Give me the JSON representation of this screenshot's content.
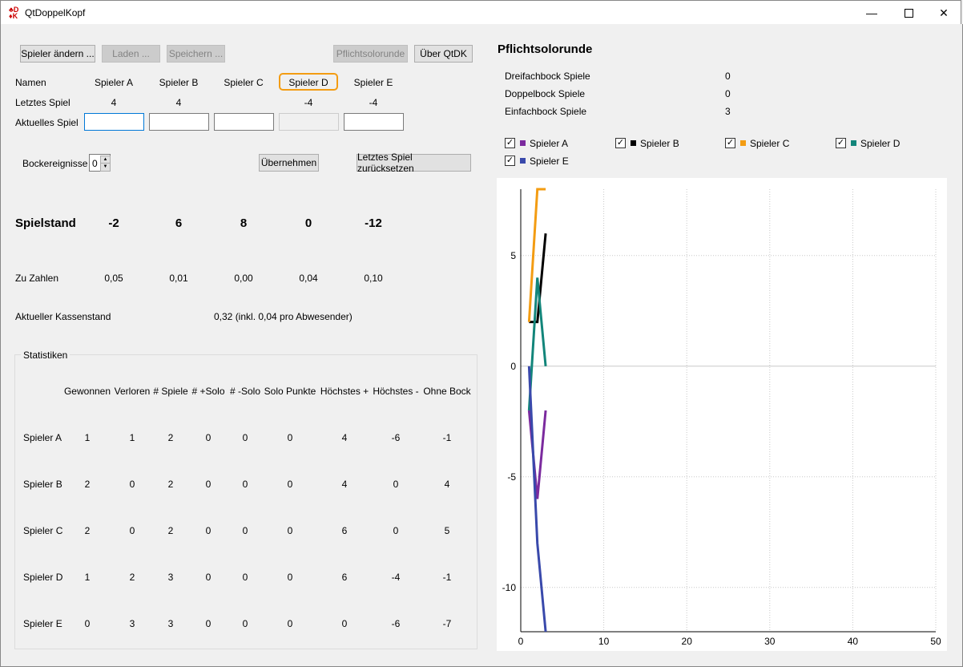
{
  "window": {
    "title": "QtDoppelKopf"
  },
  "toolbar": {
    "change_players": "Spieler ändern ...",
    "load": "Laden ...",
    "save": "Speichern ...",
    "mandatory_solo": "Pflichtsolorunde",
    "about": "Über QtDK"
  },
  "labels": {
    "names": "Namen",
    "last_game": "Letztes Spiel",
    "current_game": "Aktuelles Spiel",
    "bock_events": "Bockereignisse",
    "bock_value": "0",
    "apply": "Übernehmen",
    "reset_last": "Letztes Spiel zurücksetzen",
    "score": "Spielstand",
    "to_pay": "Zu Zahlen",
    "cash": "Aktueller Kassenstand",
    "cash_value": "0,32 (inkl. 0,04 pro Abwesender)",
    "stats": "Statistiken"
  },
  "players": [
    {
      "name": "Spieler A",
      "last": "4",
      "score": "-2",
      "pay": "0,05",
      "color": "#7b2a9e"
    },
    {
      "name": "Spieler B",
      "last": "4",
      "score": "6",
      "pay": "0,01",
      "color": "#000000"
    },
    {
      "name": "Spieler C",
      "last": "",
      "score": "8",
      "pay": "0,00",
      "color": "#f39c12"
    },
    {
      "name": "Spieler D",
      "last": "-4",
      "score": "0",
      "pay": "0,04",
      "color": "#12857a"
    },
    {
      "name": "Spieler E",
      "last": "-4",
      "score": "-12",
      "pay": "0,10",
      "color": "#3949ab"
    }
  ],
  "stats": {
    "headers": [
      "Gewonnen",
      "Verloren",
      "# Spiele",
      "# +Solo",
      "# -Solo",
      "Solo Punkte",
      "Höchstes +",
      "Höchstes -",
      "Ohne Bock"
    ],
    "rows": [
      {
        "name": "Spieler A",
        "values": [
          "1",
          "1",
          "2",
          "0",
          "0",
          "0",
          "4",
          "-6",
          "-1"
        ]
      },
      {
        "name": "Spieler B",
        "values": [
          "2",
          "0",
          "2",
          "0",
          "0",
          "0",
          "4",
          "0",
          "4"
        ]
      },
      {
        "name": "Spieler C",
        "values": [
          "2",
          "0",
          "2",
          "0",
          "0",
          "0",
          "6",
          "0",
          "5"
        ]
      },
      {
        "name": "Spieler D",
        "values": [
          "1",
          "2",
          "3",
          "0",
          "0",
          "0",
          "6",
          "-4",
          "-1"
        ]
      },
      {
        "name": "Spieler E",
        "values": [
          "0",
          "3",
          "3",
          "0",
          "0",
          "0",
          "0",
          "-6",
          "-7"
        ]
      }
    ]
  },
  "side": {
    "title": "Pflichtsolorunde",
    "rows": [
      {
        "label": "Dreifachbock Spiele",
        "value": "0"
      },
      {
        "label": "Doppelbock Spiele",
        "value": "0"
      },
      {
        "label": "Einfachbock Spiele",
        "value": "3"
      }
    ]
  },
  "chart_data": {
    "type": "line",
    "xlim": [
      0,
      50
    ],
    "ylim": [
      -12,
      8
    ],
    "x_ticks": [
      "0",
      "10",
      "20",
      "30",
      "40",
      "50"
    ],
    "y_ticks": [
      "5",
      "0",
      "-5",
      "-10"
    ],
    "y_tick_values": [
      5,
      0,
      -5,
      -10
    ],
    "grid": true,
    "legend": "top",
    "series": [
      {
        "name": "Spieler A",
        "color": "#7b2a9e",
        "checked": true,
        "x": [
          1,
          2,
          3
        ],
        "y": [
          -2,
          -6,
          -2
        ]
      },
      {
        "name": "Spieler B",
        "color": "#000000",
        "checked": true,
        "x": [
          1,
          2,
          3
        ],
        "y": [
          2,
          2,
          6
        ]
      },
      {
        "name": "Spieler C",
        "color": "#f39c12",
        "checked": true,
        "x": [
          1,
          2,
          3
        ],
        "y": [
          2,
          8,
          8
        ]
      },
      {
        "name": "Spieler D",
        "color": "#12857a",
        "checked": true,
        "x": [
          1,
          2,
          3
        ],
        "y": [
          -2,
          4,
          0
        ]
      },
      {
        "name": "Spieler E",
        "color": "#3949ab",
        "checked": true,
        "x": [
          1,
          2,
          3
        ],
        "y": [
          0,
          -8,
          -12
        ]
      }
    ]
  }
}
